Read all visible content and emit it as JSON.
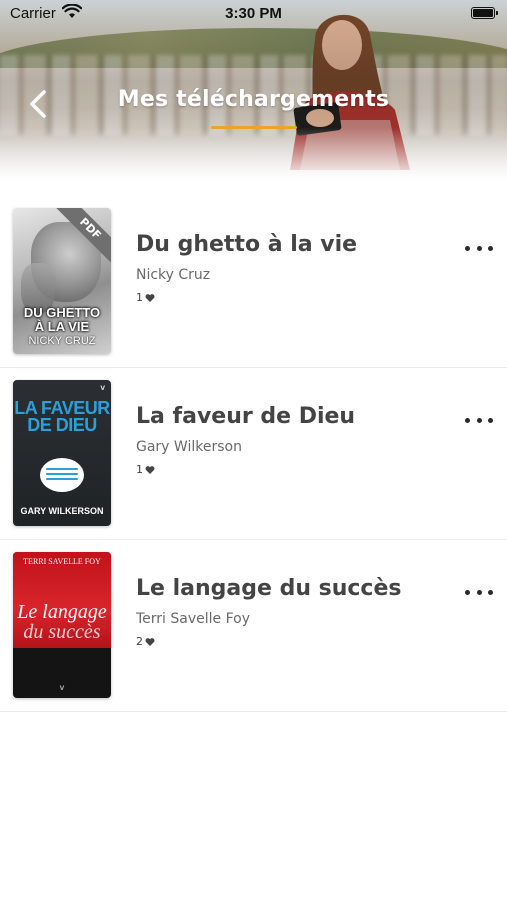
{
  "status_bar": {
    "carrier": "Carrier",
    "time": "3:30 PM"
  },
  "header": {
    "title": "Mes téléchargements",
    "accent_color": "#e7a52a"
  },
  "books": [
    {
      "title": "Du ghetto à la vie",
      "author": "Nicky Cruz",
      "likes": "1",
      "cover": {
        "badge": "PDF",
        "title_line1": "DU GHETTO",
        "title_line2": "À LA VIE",
        "author": "NICKY CRUZ"
      }
    },
    {
      "title": "La faveur de Dieu",
      "author": "Gary Wilkerson",
      "likes": "1",
      "cover": {
        "title_line1": "LA FAVEUR",
        "title_line2": "DE DIEU",
        "author": "GARY WILKERSON"
      }
    },
    {
      "title": "Le langage du succès",
      "author": "Terri Savelle Foy",
      "likes": "2",
      "cover": {
        "author": "TERRI SAVELLE FOY",
        "title_line1": "Le langage",
        "title_line2": "du succès"
      }
    }
  ],
  "icons": {
    "back": "chevron-left-icon",
    "more": "ellipsis-icon",
    "heart": "heart-icon",
    "wifi": "wifi-icon",
    "battery": "battery-icon"
  }
}
